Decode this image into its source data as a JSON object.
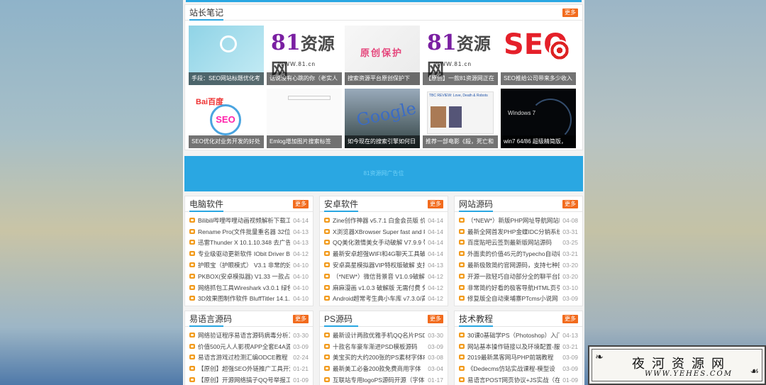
{
  "notes": {
    "title": "站长笔记",
    "more": "更多",
    "items": [
      {
        "caption": "手段：SEO网站标题优化考"
      },
      {
        "caption": "话说没有心跳的你（老实人",
        "logo_big": "81",
        "logo_rest": "资源网",
        "logo_url": "WWW.81.cn"
      },
      {
        "caption": "搜索资源平台原创保护下",
        "badge": "原创保护"
      },
      {
        "caption": "【原创】一款81资源网正在",
        "logo_big": "81",
        "logo_rest": "资源网",
        "logo_url": "WWW.81.cn"
      },
      {
        "caption": "SEO推给公司带来多少收入",
        "badge": "SEO"
      },
      {
        "caption": "SEO优化对业务开发的好处",
        "badge": "SEO",
        "brand": "Bai百度"
      },
      {
        "caption": "Emlog增加图片搜索标签"
      },
      {
        "caption": "如今现在的搜索引擎如何日",
        "badge": "Google"
      },
      {
        "caption": "推荐一部电影《殺，死亡和",
        "headline": "TBC REVIEW: Love, Death & Robots"
      },
      {
        "caption": "win7 64/86 超级精简版，",
        "badge": "Windows 7"
      }
    ]
  },
  "ad": {
    "text": "81资源网广告位"
  },
  "sections": [
    {
      "title": "电脑软件",
      "more": "更多",
      "items": [
        {
          "text": "Bilibili哔哩哔哩动画视频解析下载工",
          "date": "04-14"
        },
        {
          "text": "Rename Pro(文件批量重名器 32位 6",
          "date": "04-13"
        },
        {
          "text": "迅雷Thunder X 10.1.10.348 去广告",
          "date": "04-13"
        },
        {
          "text": "专业级驱动更新软件 IObit Driver Bo",
          "date": "04-12"
        },
        {
          "text": "护眼宝（护眼模式） V3.1 非常的好用",
          "date": "04-10"
        },
        {
          "text": "PKBOX(安卓模拟器) V1.33 一款占用",
          "date": "04-10"
        },
        {
          "text": "网络抓包工具Wireshark v3.0.1 绿色",
          "date": "04-10"
        },
        {
          "text": "3D效果图制作软件 BluffTitler 14.1.2.",
          "date": "04-10"
        }
      ]
    },
    {
      "title": "安卓软件",
      "more": "更多",
      "items": [
        {
          "text": "Zine创作神器 v5.7.1 白金会员版 价值",
          "date": "04-14"
        },
        {
          "text": "X浏览器XBrowser Super fast and P",
          "date": "04-14"
        },
        {
          "text": "QQ美化激情美女手动破解 V7.9.9 带",
          "date": "04-14"
        },
        {
          "text": "最新安卓超强WIFI和4G聊天工具破解",
          "date": "04-14"
        },
        {
          "text": "安卓高星模拟器VIP特权版破解 支持",
          "date": "04-13"
        },
        {
          "text": "（*NEW*）微信背景音 V1.0.9破解版",
          "date": "04-12"
        },
        {
          "text": "麻麻漫画 v1.0.3 破解版 无需付费 免",
          "date": "04-12"
        },
        {
          "text": "Android超常考生典小车库 v7.3.0/高",
          "date": "04-12"
        }
      ]
    },
    {
      "title": "网站源码",
      "more": "更多",
      "items": [
        {
          "text": "（*NEW*）新版PHP网址导航网站时代",
          "date": "04-08"
        },
        {
          "text": "最新全网首发PHP金蝶IDC分销系统",
          "date": "03-31"
        },
        {
          "text": "百度贴吧云签到最新版网站源码",
          "date": "03-25"
        },
        {
          "text": "外面卖的价值45元的Typecho自动收",
          "date": "03-21"
        },
        {
          "text": "最新极致简约官网源码，支持七种图",
          "date": "03-20"
        },
        {
          "text": "开源一款轻巧自动部分全的聊平台网",
          "date": "03-20"
        },
        {
          "text": "非常简约好看的极客导航HTML页引",
          "date": "03-10"
        },
        {
          "text": "修复版全自动柬埔寨PTcms小说网",
          "date": "03-09"
        }
      ]
    },
    {
      "title": "易语言源码",
      "more": "更多",
      "items": [
        {
          "text": "网络验证程序易语言源码病毒分析工具",
          "date": "03-30"
        },
        {
          "text": "价值500元人人影视APP全套E4A源码",
          "date": "03-09"
        },
        {
          "text": "易语言游戏过检测汇编ODCE教程",
          "date": "02-24"
        },
        {
          "text": "【原创】超强SEO外链推广工具开源",
          "date": "01-21"
        },
        {
          "text": "【原创】开源网络搞子QQ号举报工具",
          "date": "01-09"
        }
      ]
    },
    {
      "title": "PS源码",
      "more": "更多",
      "items": [
        {
          "text": "最新设计两款优雅手机QQ名片PSD源",
          "date": "03-30"
        },
        {
          "text": "十款名车豪车渐进PSD模板源码",
          "date": "03-09"
        },
        {
          "text": "美宝买的大约200张的PS素材字体PSD",
          "date": "03-08"
        },
        {
          "text": "最新美工必备200款免费商用字体",
          "date": "03-04"
        },
        {
          "text": "互联站专用logoPS源码开源（字体打",
          "date": "01-17"
        }
      ]
    },
    {
      "title": "技术教程",
      "more": "更多",
      "items": [
        {
          "text": "30课0基础学PS（Photoshop）入门",
          "date": "04-13"
        },
        {
          "text": "网站基本操作链接以及环境配置-服务",
          "date": "03-21"
        },
        {
          "text": "2019最新黑客网马PHP前端教程",
          "date": "03-09"
        },
        {
          "text": "《Dedecms仿站实战课程-模型设",
          "date": "03-09"
        },
        {
          "text": "易语言POST网页协议+JS实战（在线",
          "date": "01-09"
        }
      ]
    }
  ],
  "watermark": {
    "cn": "夜河资源网",
    "en": "WWW.YEHES.COM"
  }
}
